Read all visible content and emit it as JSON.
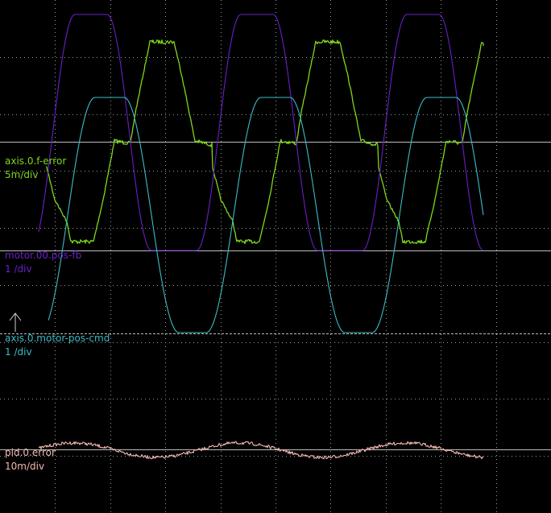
{
  "scope": {
    "background": "#000000",
    "grid_color": "#9a9a9a",
    "baseline_color": "#bdbdbd",
    "vertical_divisions": 10,
    "horizontal_divisions": 9
  },
  "channels": [
    {
      "id": "axis-0-f-error",
      "name": "axis.0.f-error",
      "scale": "5m/div",
      "color": "#7fd81a",
      "waveform": "f-error"
    },
    {
      "id": "motor-00-pos-fb",
      "name": "motor.00.pos-fb",
      "scale": "1 /div",
      "color": "#6a1fc6",
      "waveform": "pos-fb"
    },
    {
      "id": "axis-0-motor-pos-cmd",
      "name": "axis.0.motor-pos-cmd",
      "scale": "1 /div",
      "color": "#3bbcc6",
      "waveform": "pos-cmd",
      "trigger_marker": true
    },
    {
      "id": "pid-0-error",
      "name": "pid.0.error",
      "scale": "10m/div",
      "color": "#f2b8b0",
      "waveform": "pid-error"
    }
  ]
}
